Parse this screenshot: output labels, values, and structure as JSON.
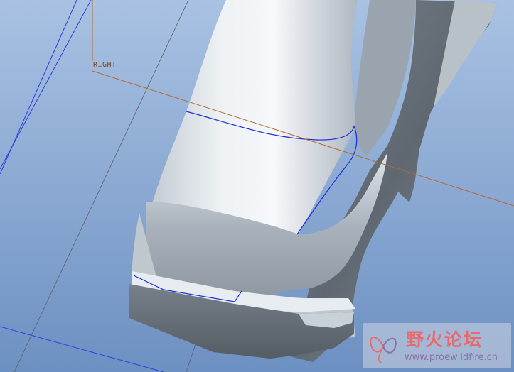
{
  "viewport": {
    "background_top": "#a9c2e3",
    "background_bottom": "#6d90c2"
  },
  "datum_plane": {
    "label": "RIGHT",
    "color": "#b76a2e"
  },
  "model": {
    "light": "#f4f7fa",
    "mid": "#c9d1d9",
    "dark": "#66707a",
    "sketch_color": "#1b2fd6"
  },
  "watermark": {
    "title": "野火论坛",
    "url": "www.proewildfire.cn",
    "title_color": "#e56b6f",
    "url_color": "#8a6fa8",
    "logo_icon": "butterfly-logo-icon"
  }
}
